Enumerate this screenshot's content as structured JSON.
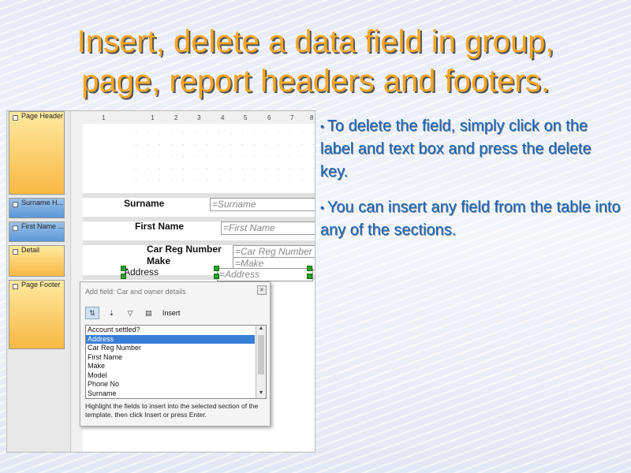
{
  "slide": {
    "title_line1": "Insert, delete a data field in group,",
    "title_line2": "page, report headers and footers.",
    "bullets": [
      "To delete the field, simply click on the label and text box and press the delete key.",
      "You can insert any field from the table into any of the sections."
    ]
  },
  "report": {
    "sections": [
      "Page Header",
      "Surname H...",
      "First Name ...",
      "Detail",
      "Page Footer"
    ],
    "ruler_marks": [
      "1",
      "1",
      "2",
      "3",
      "4",
      "5",
      "6",
      "7",
      "8"
    ],
    "labels": {
      "surname": "Surname",
      "first_name": "First Name",
      "car_reg": "Car Reg Number",
      "make": "Make",
      "address": "Address"
    },
    "fields": {
      "surname": "=Surname",
      "first_name": "=First Name",
      "car_reg": "=Car Reg Number",
      "make": "=Make",
      "address": "=Address"
    }
  },
  "dialog": {
    "title": "Add field: Car and owner details",
    "insert_label": "Insert",
    "items": [
      "Account settled?",
      "Address",
      "Car Reg Number",
      "First Name",
      "Make",
      "Model",
      "Phone No",
      "Surname"
    ],
    "selected_index": 1,
    "help_text": "Highlight the fields to insert into the selected section of the template, then click Insert or press Enter."
  },
  "colors": {
    "title": "#f5a623",
    "bullet": "#1565c0",
    "section_orange": "#f7b843",
    "section_blue": "#5a95d6",
    "selection": "#3a7fd6"
  }
}
